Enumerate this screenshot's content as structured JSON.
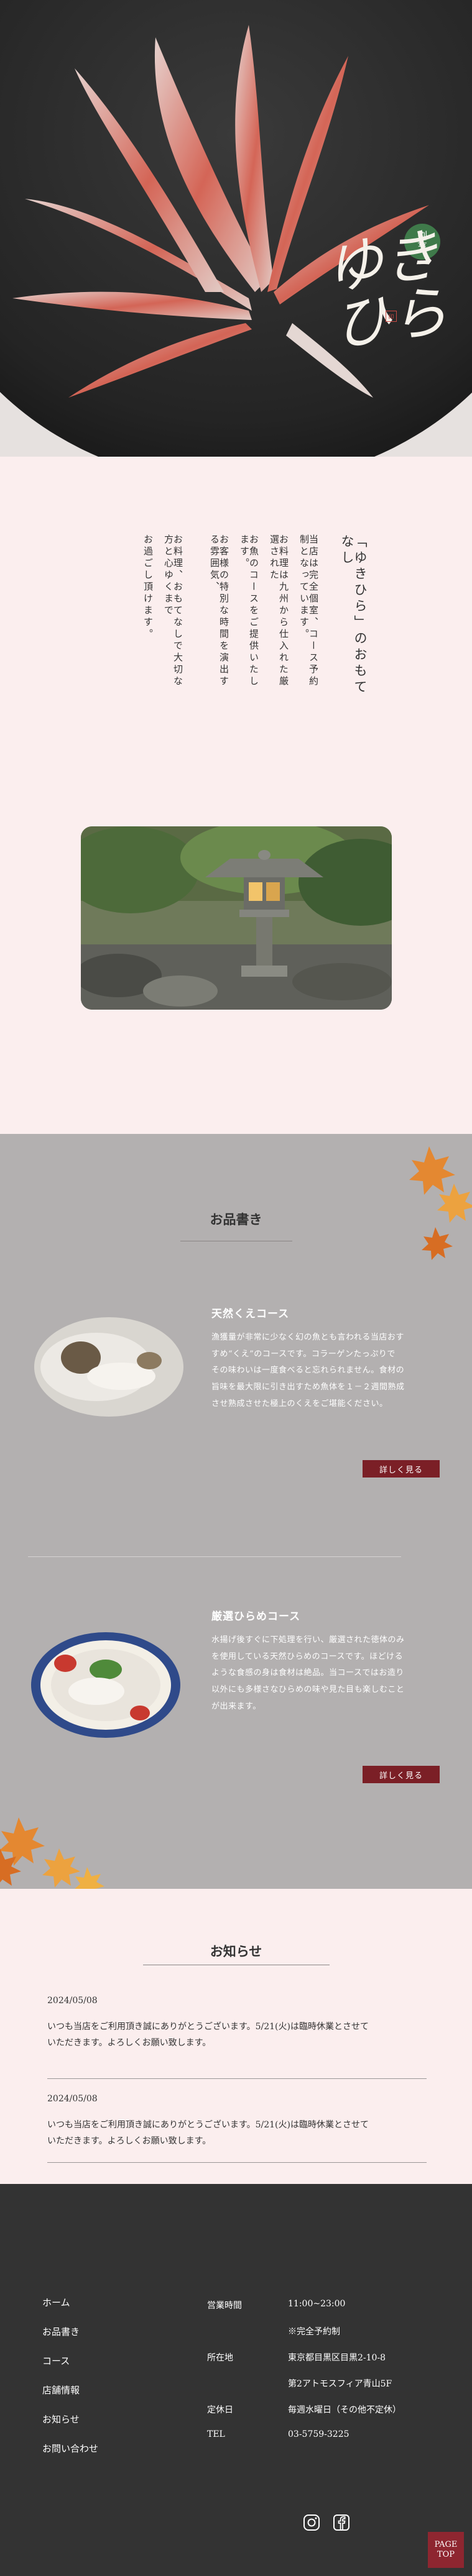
{
  "hero": {
    "logo_badge_top": "割",
    "logo_badge_bottom": "烹",
    "logo_script": "ゆきひら",
    "logo_seal": "印"
  },
  "intro": {
    "title": "「ゆきひら」のおもてなし",
    "lines": [
      "当店は完全個室、コース予約制となっています。",
      "お料理は九州から仕入れた厳選された",
      "お魚のコースをご提供いたします。",
      "お客様の特別な時間を演出する雰囲気、",
      "お料理、おもてなしで大切な方と心ゆくまで",
      "お過ごし頂けます。"
    ]
  },
  "menu": {
    "title": "お品書き",
    "courses": [
      {
        "name": "天然くえコース",
        "lines": [
          "漁獲量が非常に少なく幻の魚とも言われる当店おす",
          "すめ“くえ”のコースです。コラーゲンたっぷりで",
          "その味わいは一度食べると忘れられません。食材の",
          "旨味を最大限に引き出すため魚体を１－２週間熟成",
          "させ熟成させた極上のくえをご堪能ください。"
        ],
        "button": "詳しく見る"
      },
      {
        "name": "厳選ひらめコース",
        "lines": [
          "水揚げ後すぐに下処理を行い、厳選された徳体のみ",
          "を使用している天然ひらめのコースです。ほどける",
          "ような食感の身は食材は絶品。当コースではお造り",
          "以外にも多様さなひらめの味や見た目も楽しむこと",
          "が出来ます。"
        ],
        "button": "詳しく見る"
      }
    ]
  },
  "news": {
    "title": "お知らせ",
    "items": [
      {
        "date": "2024/05/08",
        "line1": "いつも当店をご利用頂き誠にありがとうございます。5/21(火)は臨時休業とさせて",
        "line2": "いただきます。よろしくお願い致します。"
      },
      {
        "date": "2024/05/08",
        "line1": "いつも当店をご利用頂き誠にありがとうございます。5/21(火)は臨時休業とさせて",
        "line2": "いただきます。よろしくお願い致します。"
      }
    ]
  },
  "footer": {
    "nav": [
      "ホーム",
      "お品書き",
      "コース",
      "店舗情報",
      "お知らせ",
      "お問い合わせ"
    ],
    "hours_label": "営業時間",
    "hours_value": "11:00~23:00",
    "reservation_note": "※完全予約制",
    "address_label": "所在地",
    "address_line1": "東京都目黒区目黒2-10-8",
    "address_line2": "第2アトモスフィア青山5F",
    "closed_label": "定休日",
    "closed_value": "毎週水曜日（その他不定休）",
    "tel_label": "TEL",
    "tel_value": "03-5759-3225",
    "pagetop_line1": "PAGE",
    "pagetop_line2": "TOP"
  },
  "colors": {
    "accent": "#7b1f26",
    "pink_bg": "#fbeeee",
    "menu_bg": "#b3b0b0",
    "footer_bg": "#333333"
  },
  "icons": [
    "instagram-icon",
    "facebook-icon",
    "maple-leaf-icon"
  ]
}
